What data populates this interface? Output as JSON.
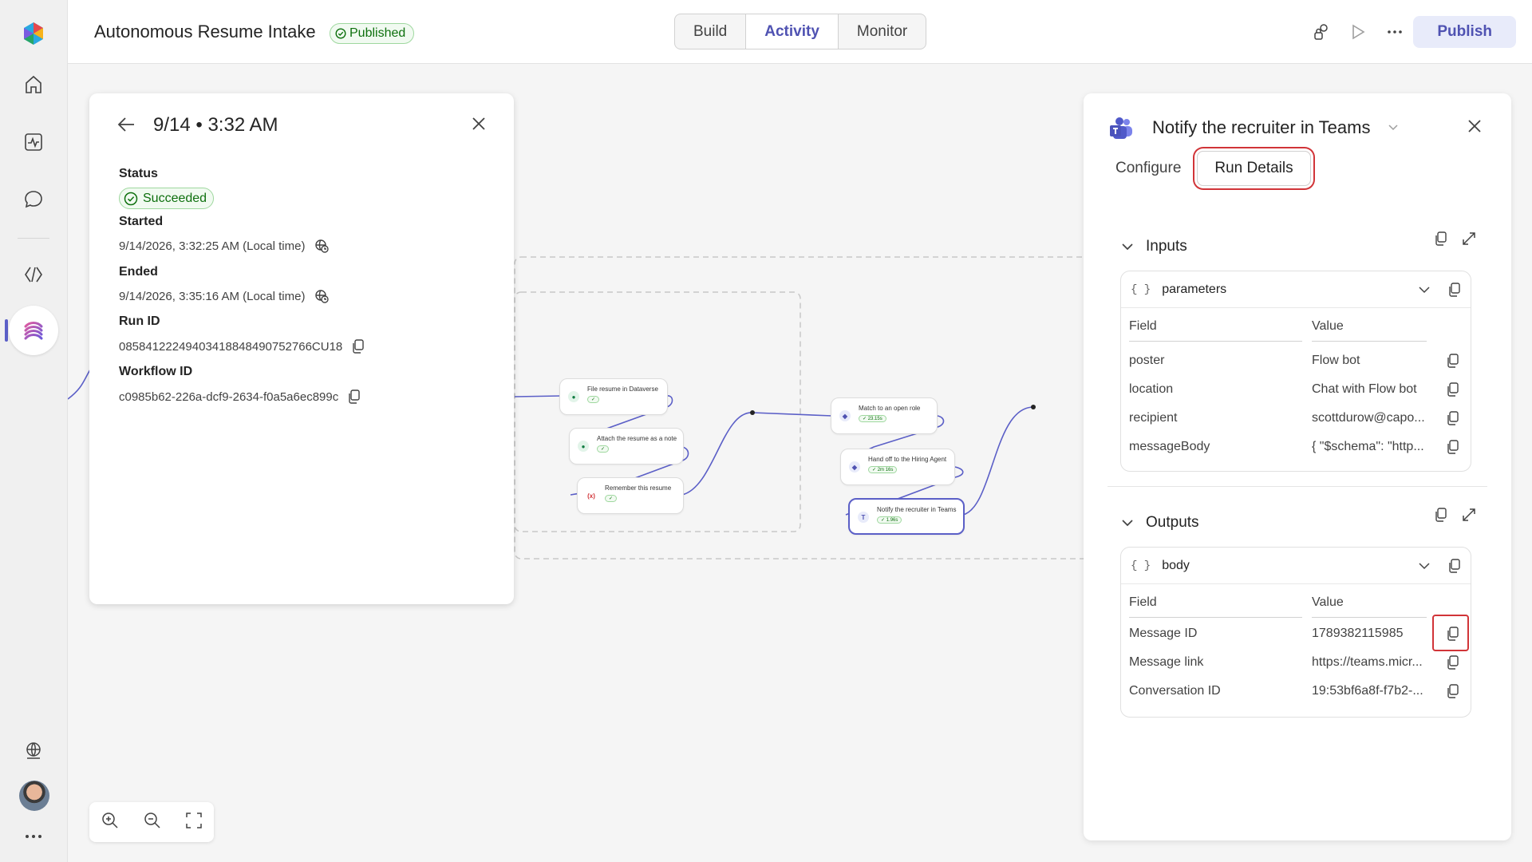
{
  "header": {
    "title": "Autonomous Resume Intake",
    "status_badge": "Published",
    "tabs": [
      "Build",
      "Activity",
      "Monitor"
    ],
    "active_tab": "Activity",
    "publish_label": "Publish"
  },
  "canvas": {
    "nodes": [
      {
        "label": "File resume in Dataverse",
        "duration": ""
      },
      {
        "label": "Attach the resume as a note",
        "duration": ""
      },
      {
        "label": "Remember this resume",
        "duration": ""
      },
      {
        "label": "Match to an open role",
        "duration": "23.15s"
      },
      {
        "label": "Hand off to the Hiring Agent",
        "duration": "2m 16s"
      },
      {
        "label": "Notify the recruiter in Teams",
        "duration": "1.96s"
      }
    ]
  },
  "run": {
    "title": "9/14 • 3:32 AM",
    "status_label": "Status",
    "status_value": "Succeeded",
    "started_label": "Started",
    "started_value": "9/14/2026, 3:32:25 AM (Local time)",
    "ended_label": "Ended",
    "ended_value": "9/14/2026, 3:35:16 AM (Local time)",
    "run_id_label": "Run ID",
    "run_id_value": "08584122249403418848490752766CU18",
    "workflow_id_label": "Workflow ID",
    "workflow_id_value": "c0985b62-226a-dcf9-2634-f0a5a6ec899c"
  },
  "detail": {
    "title": "Notify the recruiter in Teams",
    "tabs": [
      "Configure",
      "Run Details"
    ],
    "active_tab": "Run Details",
    "inputs": {
      "heading": "Inputs",
      "card_title": "parameters",
      "field_header": "Field",
      "value_header": "Value",
      "rows": [
        {
          "field": "poster",
          "value": "Flow bot"
        },
        {
          "field": "location",
          "value": "Chat with Flow bot"
        },
        {
          "field": "recipient",
          "value": "scottdurow@capo..."
        },
        {
          "field": "messageBody",
          "value": "{ \"$schema\": \"http..."
        }
      ]
    },
    "outputs": {
      "heading": "Outputs",
      "card_title": "body",
      "field_header": "Field",
      "value_header": "Value",
      "rows": [
        {
          "field": "Message ID",
          "value": "1789382115985"
        },
        {
          "field": "Message link",
          "value": "https://teams.micr..."
        },
        {
          "field": "Conversation ID",
          "value": "19:53bf6a8f-f7b2-..."
        }
      ]
    }
  },
  "colors": {
    "accent": "#5b5fc7",
    "success": "#0e700e",
    "highlight": "#d13438"
  }
}
